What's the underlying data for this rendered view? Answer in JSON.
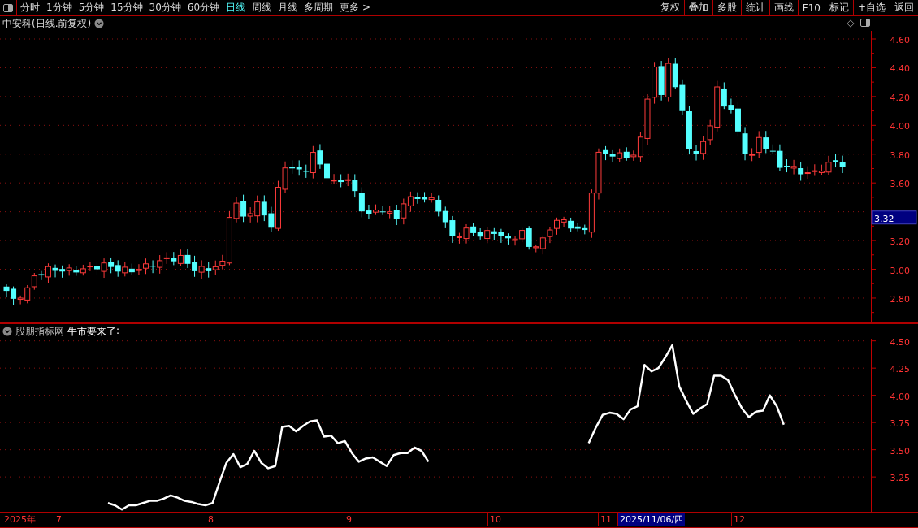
{
  "toolbar": {
    "periods": [
      {
        "label": "分时",
        "selected": false
      },
      {
        "label": "1分钟",
        "selected": false
      },
      {
        "label": "5分钟",
        "selected": false
      },
      {
        "label": "15分钟",
        "selected": false
      },
      {
        "label": "30分钟",
        "selected": false
      },
      {
        "label": "60分钟",
        "selected": false
      },
      {
        "label": "日线",
        "selected": true
      },
      {
        "label": "周线",
        "selected": false
      },
      {
        "label": "月线",
        "selected": false
      },
      {
        "label": "多周期",
        "selected": false
      },
      {
        "label": "更多 >",
        "selected": false
      }
    ],
    "tools": [
      "复权",
      "叠加",
      "多股",
      "统计",
      "画线",
      "F10",
      "标记",
      "+自选",
      "返回"
    ]
  },
  "main_chart": {
    "title": "中安科(日线.前复权)",
    "price_ticks": [
      "4.60",
      "4.40",
      "4.20",
      "4.00",
      "3.80",
      "3.60",
      "3.20",
      "3.00",
      "2.80"
    ],
    "current_price": "3.32"
  },
  "indicator": {
    "name": "股朋指标网",
    "readout": ":-",
    "chart_data": {
      "type": "line",
      "grid": true,
      "ylim": [
        2.93,
        4.52
      ],
      "yticks": [
        {
          "value": 4.5,
          "label": "4.50"
        },
        {
          "value": 4.25,
          "label": "4.25"
        },
        {
          "value": 4.0,
          "label": "4.00"
        },
        {
          "value": 3.75,
          "label": "3.75"
        },
        {
          "value": 3.5,
          "label": "3.50"
        },
        {
          "value": 3.25,
          "label": "3.25"
        }
      ],
      "series": [
        {
          "name": "牛市要来了",
          "color": "#ffffff",
          "values": [
            null,
            null,
            null,
            null,
            null,
            null,
            null,
            null,
            null,
            null,
            null,
            null,
            null,
            null,
            null,
            3.01,
            2.99,
            2.95,
            2.99,
            2.99,
            3.01,
            3.03,
            3.03,
            3.05,
            3.08,
            3.06,
            3.03,
            3.02,
            3.0,
            2.99,
            3.01,
            3.2,
            3.38,
            3.46,
            3.34,
            3.37,
            3.49,
            3.38,
            3.33,
            3.35,
            3.71,
            3.72,
            3.67,
            3.72,
            3.76,
            3.77,
            3.62,
            3.63,
            3.56,
            3.58,
            3.47,
            3.39,
            3.42,
            3.43,
            3.39,
            3.35,
            3.45,
            3.47,
            3.47,
            3.52,
            3.49,
            3.39,
            null,
            null,
            null,
            null,
            null,
            null,
            null,
            null,
            null,
            null,
            null,
            null,
            null,
            null,
            null,
            null,
            null,
            null,
            null,
            null,
            null,
            null,
            3.56,
            3.7,
            3.82,
            3.84,
            3.83,
            3.78,
            3.87,
            3.9,
            4.28,
            4.22,
            4.25,
            4.35,
            4.46,
            4.08,
            3.95,
            3.83,
            3.88,
            3.92,
            4.18,
            4.18,
            4.14,
            4.0,
            3.88,
            3.8,
            3.85,
            3.86,
            4.0,
            3.9,
            3.73,
            null,
            null,
            null,
            null,
            null,
            null,
            null,
            null,
            null,
            null,
            null,
            null
          ]
        }
      ]
    }
  },
  "date_axis": {
    "labels": [
      {
        "text": "2025年",
        "selected": false
      },
      {
        "text": "7",
        "selected": false
      },
      {
        "text": "8",
        "selected": false
      },
      {
        "text": "9",
        "selected": false
      },
      {
        "text": "10",
        "selected": false
      },
      {
        "text": "11",
        "selected": false
      },
      {
        "text": "2025/11/06/四",
        "selected": true
      },
      {
        "text": "12",
        "selected": false
      }
    ]
  }
}
